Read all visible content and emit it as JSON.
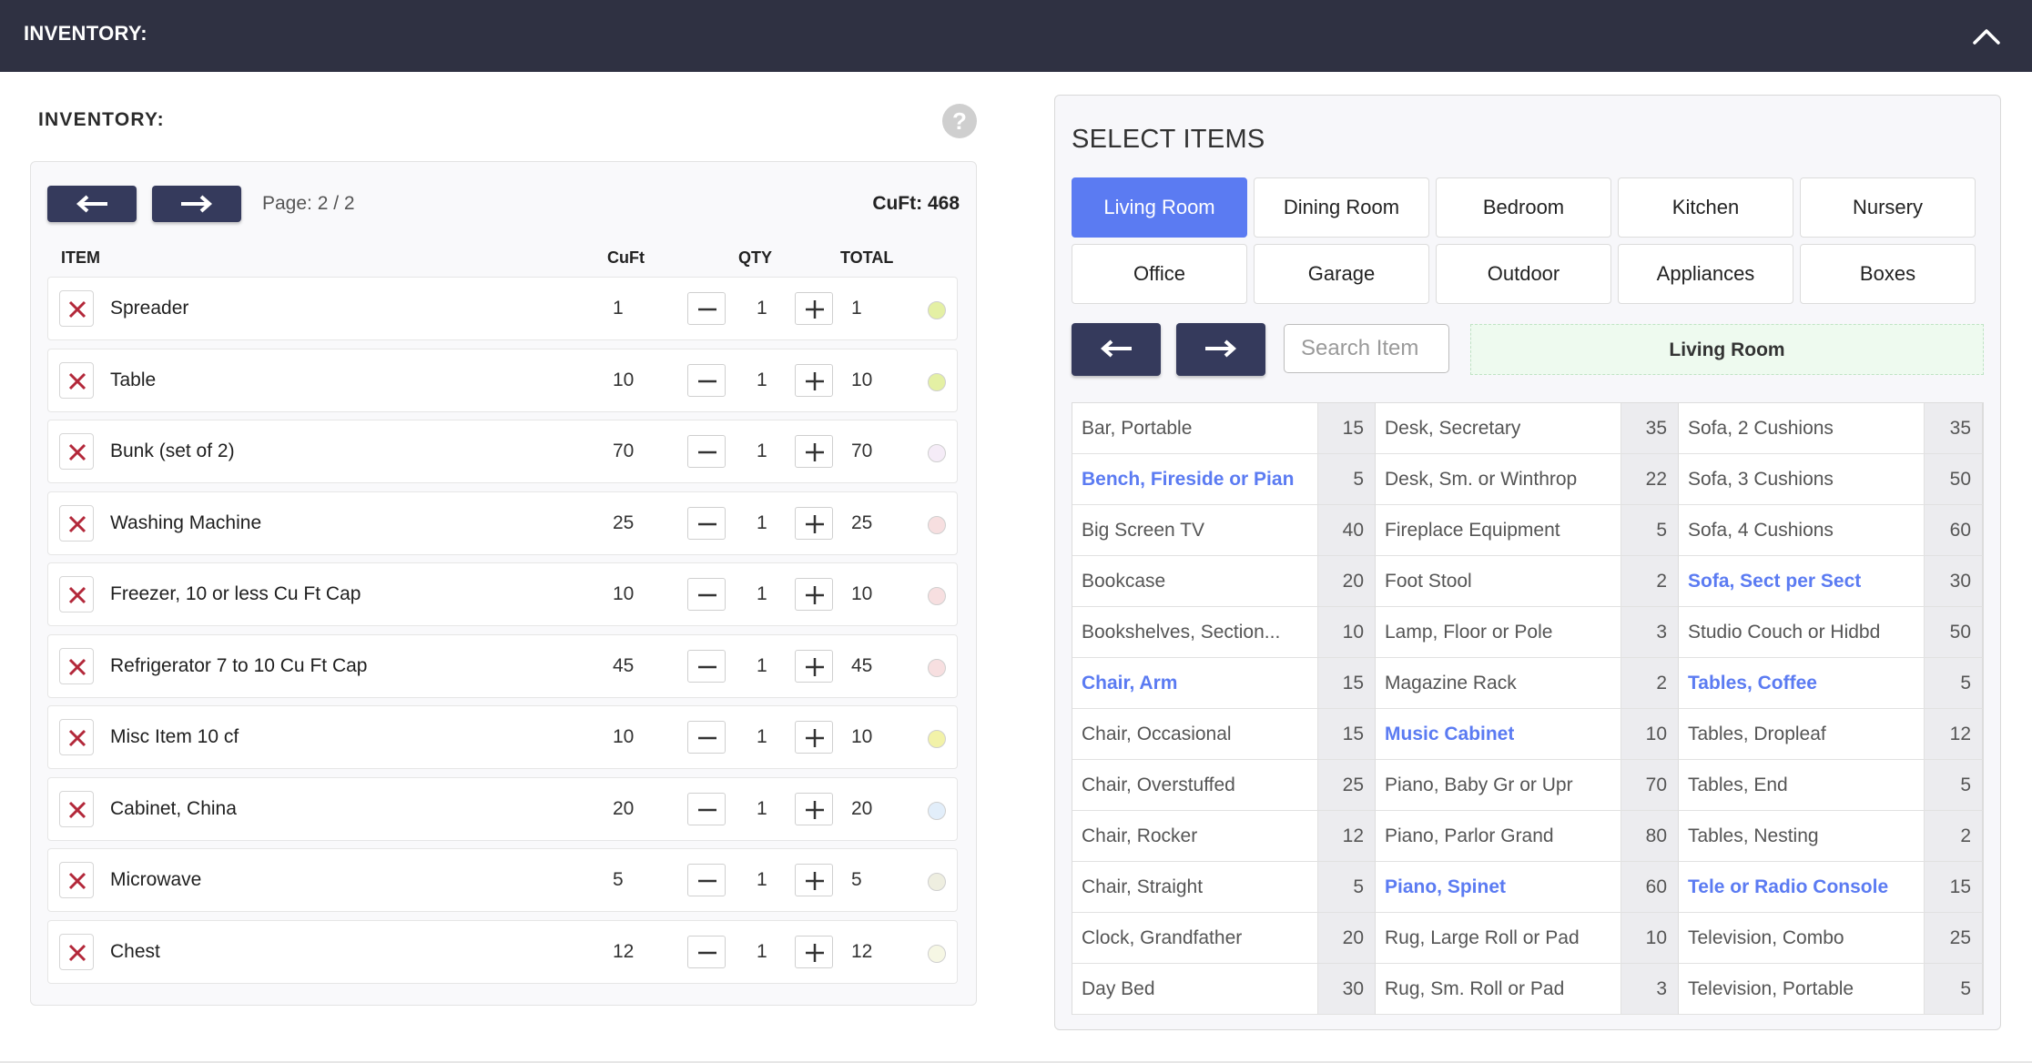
{
  "header": {
    "title": "INVENTORY:"
  },
  "inventory": {
    "heading": "INVENTORY:",
    "help_label": "?",
    "page_label": "Page: 2 / 2",
    "cuft_total": "CuFt: 468",
    "columns": {
      "item": "ITEM",
      "cuft": "CuFt",
      "qty": "QTY",
      "total": "TOTAL"
    },
    "rows": [
      {
        "name": "Spreader",
        "cuft": "1",
        "qty": "1",
        "total": "1",
        "color": "#e4f0a4"
      },
      {
        "name": "Table",
        "cuft": "10",
        "qty": "1",
        "total": "10",
        "color": "#e4f0a4"
      },
      {
        "name": "Bunk (set of 2)",
        "cuft": "70",
        "qty": "1",
        "total": "70",
        "color": "#f5ecf7"
      },
      {
        "name": "Washing Machine",
        "cuft": "25",
        "qty": "1",
        "total": "25",
        "color": "#f7dfe0"
      },
      {
        "name": "Freezer, 10 or less Cu Ft Cap",
        "cuft": "10",
        "qty": "1",
        "total": "10",
        "color": "#f7dfe0"
      },
      {
        "name": "Refrigerator 7 to 10 Cu Ft Cap",
        "cuft": "45",
        "qty": "1",
        "total": "45",
        "color": "#f7dfe0"
      },
      {
        "name": "Misc Item 10 cf",
        "cuft": "10",
        "qty": "1",
        "total": "10",
        "color": "#f2f2a8"
      },
      {
        "name": "Cabinet, China",
        "cuft": "20",
        "qty": "1",
        "total": "20",
        "color": "#e2eefa"
      },
      {
        "name": "Microwave",
        "cuft": "5",
        "qty": "1",
        "total": "5",
        "color": "#eeeee0"
      },
      {
        "name": "Chest",
        "cuft": "12",
        "qty": "1",
        "total": "12",
        "color": "#f6f7e4"
      }
    ]
  },
  "select": {
    "title": "SELECT ITEMS",
    "rooms": [
      "Living Room",
      "Dining Room",
      "Bedroom",
      "Kitchen",
      "Nursery",
      "Office",
      "Garage",
      "Outdoor",
      "Appliances",
      "Boxes"
    ],
    "active_room": "Living Room",
    "search_placeholder": "Search Item",
    "banner": "Living Room",
    "accent": "#5b7bf2",
    "items": [
      [
        {
          "name": "Bar, Portable",
          "cuft": "15",
          "hl": false
        },
        {
          "name": "Bench, Fireside or Pian",
          "cuft": "5",
          "hl": true
        },
        {
          "name": "Big Screen TV",
          "cuft": "40",
          "hl": false
        },
        {
          "name": "Bookcase",
          "cuft": "20",
          "hl": false
        },
        {
          "name": "Bookshelves, Section...",
          "cuft": "10",
          "hl": false
        },
        {
          "name": "Chair, Arm",
          "cuft": "15",
          "hl": true
        },
        {
          "name": "Chair, Occasional",
          "cuft": "15",
          "hl": false
        },
        {
          "name": "Chair, Overstuffed",
          "cuft": "25",
          "hl": false
        },
        {
          "name": "Chair, Rocker",
          "cuft": "12",
          "hl": false
        },
        {
          "name": "Chair, Straight",
          "cuft": "5",
          "hl": false
        },
        {
          "name": "Clock, Grandfather",
          "cuft": "20",
          "hl": false
        },
        {
          "name": "Day Bed",
          "cuft": "30",
          "hl": false
        }
      ],
      [
        {
          "name": "Desk, Secretary",
          "cuft": "35",
          "hl": false
        },
        {
          "name": "Desk, Sm. or Winthrop",
          "cuft": "22",
          "hl": false
        },
        {
          "name": "Fireplace Equipment",
          "cuft": "5",
          "hl": false
        },
        {
          "name": "Foot Stool",
          "cuft": "2",
          "hl": false
        },
        {
          "name": "Lamp, Floor or Pole",
          "cuft": "3",
          "hl": false
        },
        {
          "name": "Magazine Rack",
          "cuft": "2",
          "hl": false
        },
        {
          "name": "Music Cabinet",
          "cuft": "10",
          "hl": true
        },
        {
          "name": "Piano, Baby Gr or Upr",
          "cuft": "70",
          "hl": false
        },
        {
          "name": "Piano, Parlor Grand",
          "cuft": "80",
          "hl": false
        },
        {
          "name": "Piano, Spinet",
          "cuft": "60",
          "hl": true
        },
        {
          "name": "Rug, Large Roll or Pad",
          "cuft": "10",
          "hl": false
        },
        {
          "name": "Rug, Sm. Roll or Pad",
          "cuft": "3",
          "hl": false
        }
      ],
      [
        {
          "name": "Sofa, 2 Cushions",
          "cuft": "35",
          "hl": false
        },
        {
          "name": "Sofa, 3 Cushions",
          "cuft": "50",
          "hl": false
        },
        {
          "name": "Sofa, 4 Cushions",
          "cuft": "60",
          "hl": false
        },
        {
          "name": "Sofa, Sect per Sect",
          "cuft": "30",
          "hl": true
        },
        {
          "name": "Studio Couch or Hidbd",
          "cuft": "50",
          "hl": false
        },
        {
          "name": "Tables, Coffee",
          "cuft": "5",
          "hl": true
        },
        {
          "name": "Tables, Dropleaf",
          "cuft": "12",
          "hl": false
        },
        {
          "name": "Tables, End",
          "cuft": "5",
          "hl": false
        },
        {
          "name": "Tables, Nesting",
          "cuft": "2",
          "hl": false
        },
        {
          "name": "Tele or Radio Console",
          "cuft": "15",
          "hl": true
        },
        {
          "name": "Television, Combo",
          "cuft": "25",
          "hl": false
        },
        {
          "name": "Television, Portable",
          "cuft": "5",
          "hl": false
        }
      ]
    ]
  }
}
